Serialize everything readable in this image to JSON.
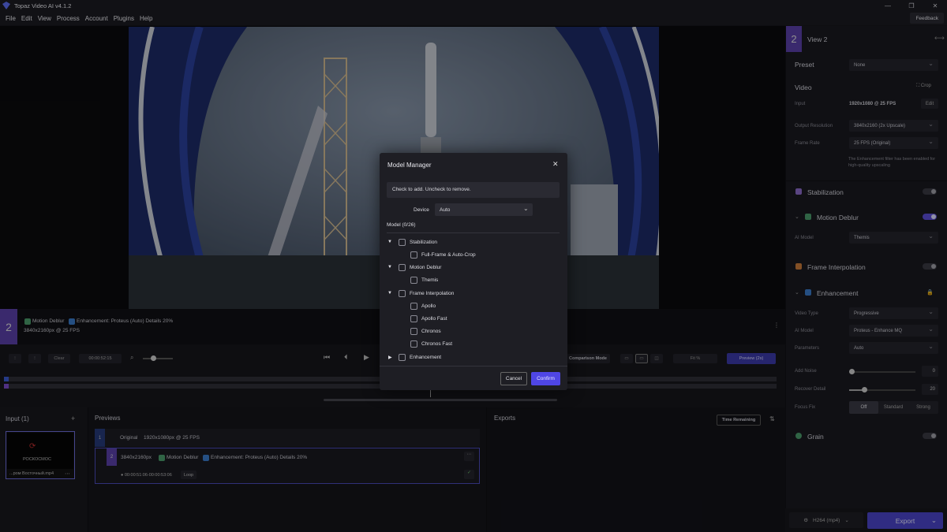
{
  "app": {
    "title": "Topaz Video AI  v4.1.2"
  },
  "menu": [
    "File",
    "Edit",
    "View",
    "Process",
    "Account",
    "Plugins",
    "Help"
  ],
  "feedback_label": "Feedback",
  "preview_info": {
    "badge": "2",
    "filters": [
      "Motion Deblur",
      "Enhancement: Proteus (Auto) Details 20%"
    ],
    "resolution": "3840x2160px @ 25 FPS"
  },
  "controls": {
    "clear": "Clear",
    "timecode": "00:00:52:15",
    "comparison_mode": "Comparison Mode",
    "fit": "Fit %",
    "preview": "Preview (2s)"
  },
  "right_panel": {
    "view_badge": "2",
    "view_title": "View 2",
    "preset_label": "Preset",
    "preset_value": "None",
    "video_head": "Video",
    "crop_label": "Crop",
    "input_label": "Input",
    "input_value": "1920x1080 @ 25 FPS",
    "edit_label": "Edit",
    "output_res_label": "Output Resolution",
    "output_res_value": "3840x2160 (2x Upscale)",
    "frame_rate_label": "Frame Rate",
    "frame_rate_value": "25 FPS (Original)",
    "note": "The Enhancement filter has been enabled for high-quality upscaling",
    "stabilization": "Stabilization",
    "motion_deblur": "Motion Deblur",
    "ai_model_label": "AI Model",
    "deblur_model": "Themis",
    "frame_interp": "Frame Interpolation",
    "enhancement": "Enhancement",
    "video_type_label": "Video Type",
    "video_type_value": "Progressive",
    "enh_model_value": "Proteus - Enhance MQ",
    "parameters_label": "Parameters",
    "parameters_value": "Auto",
    "add_noise_label": "Add Noise",
    "add_noise_value": "0",
    "recover_label": "Recover Detail",
    "recover_value": "20",
    "focus_label": "Focus Fix",
    "focus_options": [
      "Off",
      "Standard",
      "Strong"
    ],
    "grain": "Grain",
    "codec": "H264 (mp4)",
    "export_label": "Export"
  },
  "bottom": {
    "input_title": "Input (1)",
    "thumb_logo": "РОСКОСМОС",
    "thumb_name": "...ром Восточный.mp4",
    "previews_title": "Previews",
    "row1_num": "1",
    "row1_label": "Original",
    "row1_res": "1920x1080px @ 25 FPS",
    "row2_num": "2",
    "row2_res": "3840x2160px",
    "row2_f1": "Motion Deblur",
    "row2_f2": "Enhancement: Proteus (Auto) Details 20%",
    "row2_range": "00:00:51:06-00:00:53:06",
    "loop": "Loop",
    "exports_title": "Exports",
    "time_remaining": "Time Remaining"
  },
  "modal": {
    "title": "Model Manager",
    "hint": "Check to add. Uncheck to remove.",
    "device_label": "Device",
    "device_value": "Auto",
    "model_count": "Model (0/26)",
    "tree": {
      "stabilization": "Stabilization",
      "fullframe": "Full-Frame & Auto-Crop",
      "motion_deblur": "Motion Deblur",
      "themis": "Themis",
      "frame_interp": "Frame Interpolation",
      "apollo": "Apollo",
      "apollo_fast": "Apollo Fast",
      "chronos": "Chronos",
      "chronos_fast": "Chronos Fast",
      "enhancement": "Enhancement"
    },
    "cancel": "Cancel",
    "confirm": "Confirm"
  },
  "colors": {
    "accent": "#5b4ed6",
    "badge": "#5a3fa8",
    "confirm": "#4f46e5"
  }
}
